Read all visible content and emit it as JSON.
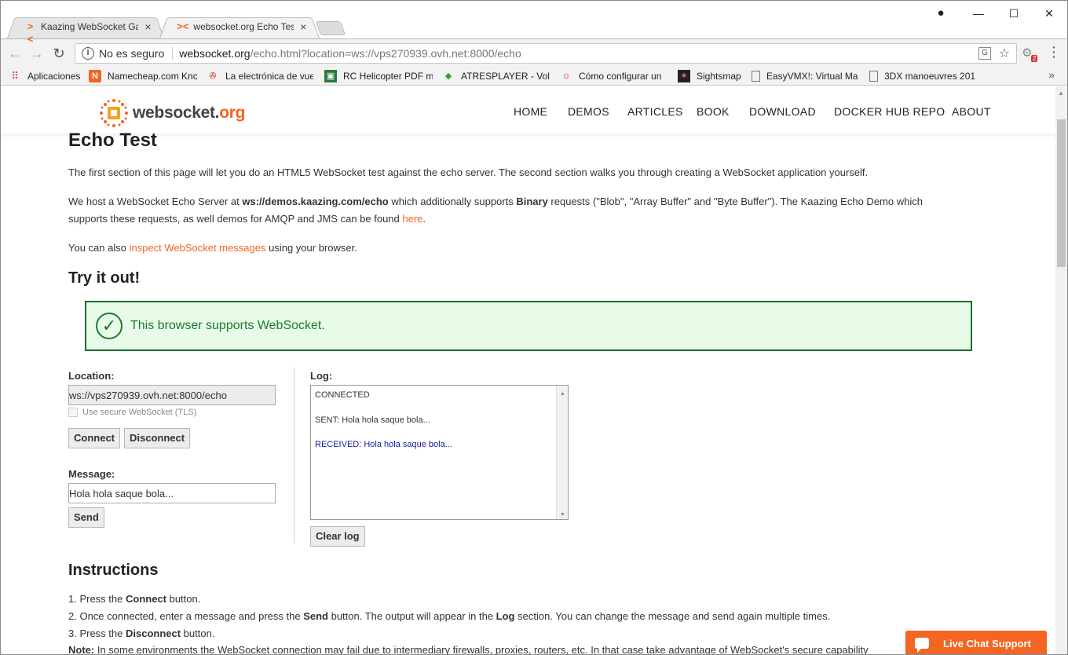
{
  "tabs": [
    {
      "title": "Kaazing WebSocket Gate",
      "favicon": "kaazing-icon"
    },
    {
      "title": "websocket.org Echo Test",
      "favicon": "kaazing-icon"
    }
  ],
  "window_controls": {
    "minimize": "—",
    "maximize": "☐",
    "close": "✕"
  },
  "address_bar": {
    "security_label": "No es seguro",
    "url_host": "websocket.org",
    "url_path": "/echo.html?location=ws://vps270939.ovh.net:8000/echo",
    "extension_badge": "2"
  },
  "bookmarks": [
    {
      "label": "Aplicaciones",
      "icon": "apps-grid-icon"
    },
    {
      "label": "Namecheap.com Knc",
      "icon": "namecheap-icon"
    },
    {
      "label": "La electrónica de vue",
      "icon": "rotor-icon"
    },
    {
      "label": "RC Helicopter PDF m",
      "icon": "rc-helicopter-icon"
    },
    {
      "label": "ATRESPLAYER - Volve",
      "icon": "atresplayer-icon"
    },
    {
      "label": "Cómo configurar un",
      "icon": "person-icon"
    },
    {
      "label": "Sightsmap",
      "icon": "sightsmap-icon"
    },
    {
      "label": "EasyVMX!: Virtual Ma",
      "icon": "page-icon"
    },
    {
      "label": "3DX manoeuvres 201",
      "icon": "page-icon"
    }
  ],
  "site": {
    "logo_text_a": "websocket.",
    "logo_text_b": "org",
    "nav": [
      "HOME",
      "DEMOS",
      "ARTICLES",
      "BOOK",
      "DOWNLOAD",
      "DOCKER HUB REPO",
      "ABOUT"
    ]
  },
  "page": {
    "title": "Echo Test",
    "intro": "The first section of this page will let you do an HTML5 WebSocket test against the echo server. The second section walks you through creating a WebSocket application yourself.",
    "host_p1": "We host a WebSocket Echo Server at ",
    "host_server": "ws://demos.kaazing.com/echo",
    "host_p2": " which additionally supports ",
    "host_binary": "Binary",
    "host_p3": " requests (\"Blob\", \"Array Buffer\" and \"Byte Buffer\"). The Kaazing Echo Demo which",
    "host_p4": "supports these requests, as well demos for AMQP and JMS can be found ",
    "host_link": "here",
    "host_p5": ".",
    "inspect_p1": "You can also ",
    "inspect_link": "inspect WebSocket messages",
    "inspect_p2": " using your browser.",
    "tryit_title": "Try it out!",
    "support_msg": "This browser supports WebSocket.",
    "location_label": "Location:",
    "location_value": "ws://vps270939.ovh.net:8000/echo",
    "tls_label": "Use secure WebSocket (TLS)",
    "connect_btn": "Connect",
    "disconnect_btn": "Disconnect",
    "message_label": "Message:",
    "message_value": "Hola hola saque bola...",
    "send_btn": "Send",
    "log_label": "Log:",
    "log": [
      "CONNECTED",
      "SENT: Hola hola saque bola...",
      "RECEIVED: Hola hola saque bola..."
    ],
    "clear_btn": "Clear log",
    "instructions_title": "Instructions",
    "step1_a": "1. Press the ",
    "step1_b": "Connect",
    "step1_c": " button.",
    "step2_a": "2. Once connected, enter a message and press the ",
    "step2_b": "Send",
    "step2_c": " button. The output will appear in the ",
    "step2_d": "Log",
    "step2_e": " section. You can change the message and send again multiple times.",
    "step3_a": "3. Press the ",
    "step3_b": "Disconnect",
    "step3_c": " button.",
    "note_a": "Note:",
    "note_b": " In some environments the WebSocket connection may fail due to intermediary firewalls, proxies, routers, etc. In that case take advantage of WebSocket's secure capability"
  },
  "chat": {
    "label": "Live Chat Support"
  },
  "colors": {
    "accent": "#f26522",
    "success": "#1c7a30",
    "success_bg": "#e8fbe8",
    "log_received": "#1a1aa6"
  }
}
